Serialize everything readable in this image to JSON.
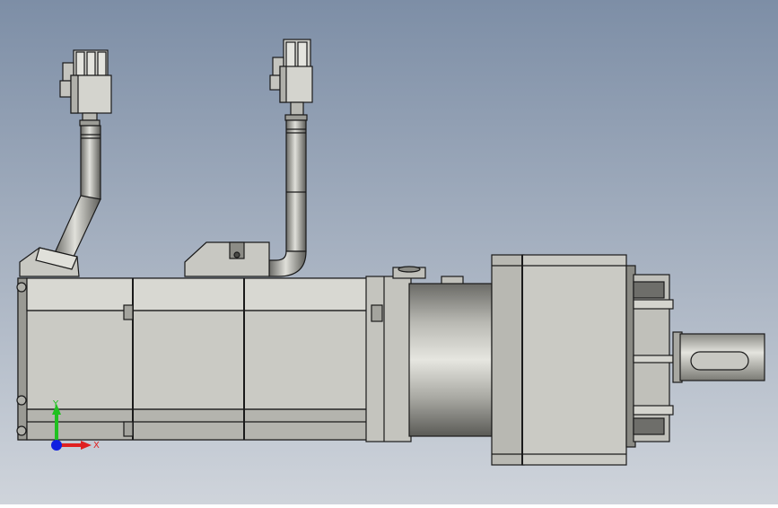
{
  "viewport": {
    "background_top": "#7d8ea6",
    "background_bottom": "#cfd4db"
  },
  "triad": {
    "x_label": "X",
    "y_label": "Y",
    "x_color": "#e02020",
    "y_color": "#20c020",
    "z_color": "#1020e0"
  },
  "model": {
    "body_color": "#c8c8c2",
    "shade_color": "#a4a49e",
    "dark_color": "#6e6e6a",
    "edge_color": "#1a1a1a"
  }
}
